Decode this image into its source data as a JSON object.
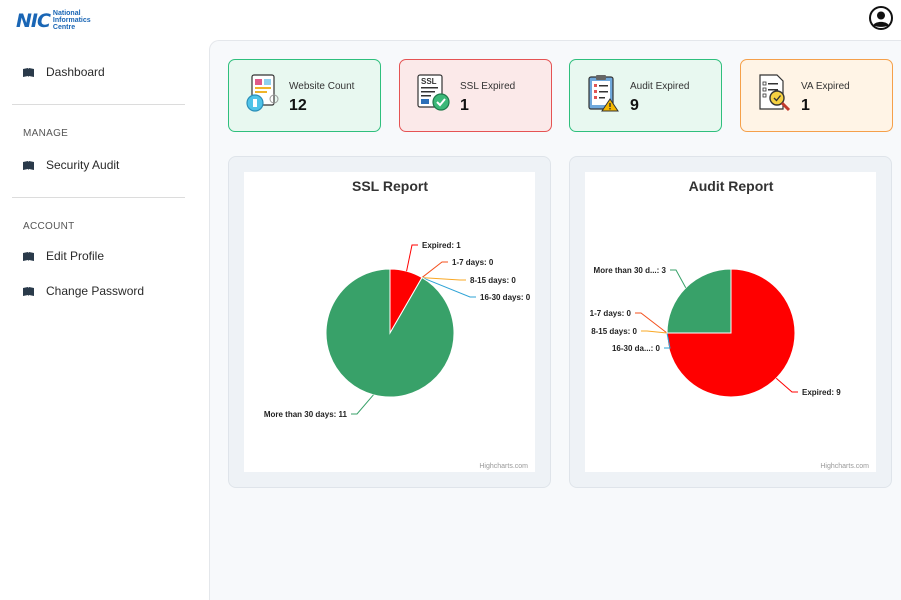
{
  "brand": {
    "logo_mark": "NIC",
    "line1": "National",
    "line2": "Informatics",
    "line3": "Centre"
  },
  "sidebar": {
    "dashboard": "Dashboard",
    "manage_heading": "MANAGE",
    "security_audit": "Security Audit",
    "account_heading": "ACCOUNT",
    "edit_profile": "Edit Profile",
    "change_password": "Change Password"
  },
  "cards": [
    {
      "label": "Website Count",
      "value": "12",
      "icon": "website-icon"
    },
    {
      "label": "SSL Expired",
      "value": "1",
      "icon": "ssl-certificate-icon"
    },
    {
      "label": "Audit Expired",
      "value": "9",
      "icon": "audit-clipboard-icon"
    },
    {
      "label": "VA Expired",
      "value": "1",
      "icon": "va-document-search-icon"
    }
  ],
  "chart_data": [
    {
      "type": "pie",
      "title": "SSL Report",
      "credit": "Highcharts.com",
      "slices": [
        {
          "label": "Expired: 1",
          "value": 1,
          "color": "#ff0000"
        },
        {
          "label": "1-7 days: 0",
          "value": 0,
          "color": "#f4511e"
        },
        {
          "label": "8-15 days: 0",
          "value": 0,
          "color": "#f9a825"
        },
        {
          "label": "16-30 days: 0",
          "value": 0,
          "color": "#2ea3d6"
        },
        {
          "label": "More than 30 days: 11",
          "value": 11,
          "color": "#38a169"
        }
      ]
    },
    {
      "type": "pie",
      "title": "Audit Report",
      "credit": "Highcharts.com",
      "slices": [
        {
          "label": "Expired: 9",
          "value": 9,
          "color": "#ff0000"
        },
        {
          "label": "1-7 days: 0",
          "value": 0,
          "color": "#f4511e"
        },
        {
          "label": "8-15 days: 0",
          "value": 0,
          "color": "#f9a825"
        },
        {
          "label": "16-30 da...: 0",
          "value": 0,
          "color": "#2ea3d6"
        },
        {
          "label": "More than 30 d...: 3",
          "value": 3,
          "color": "#38a169"
        }
      ]
    }
  ]
}
